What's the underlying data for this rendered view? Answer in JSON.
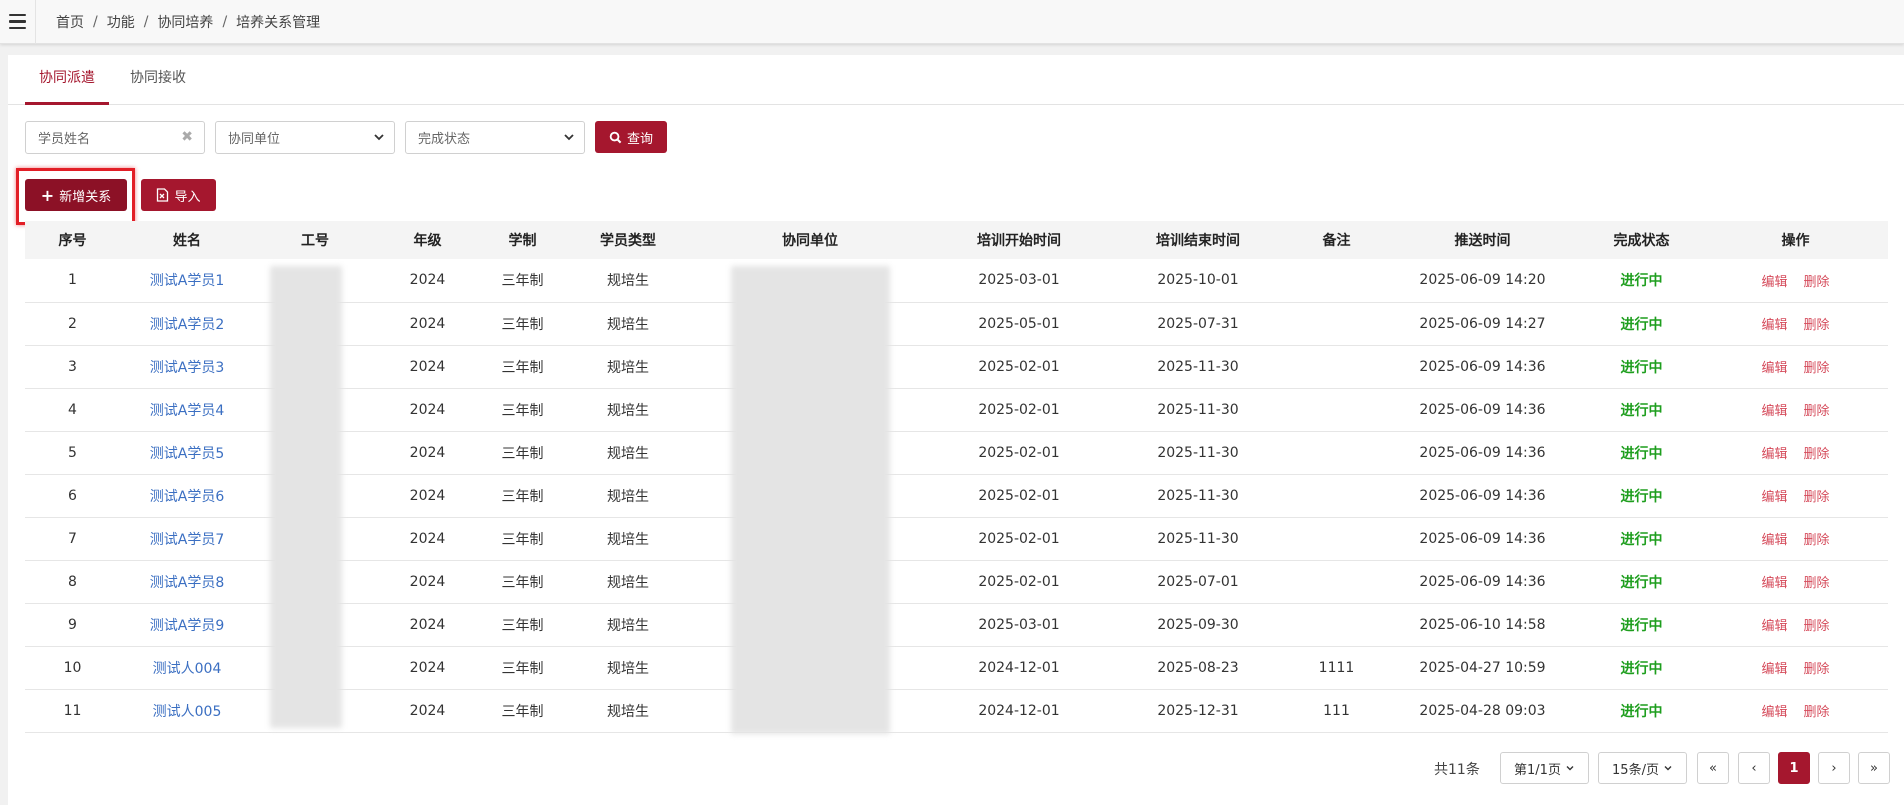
{
  "breadcrumb": [
    "首页",
    "功能",
    "协同培养",
    "培养关系管理"
  ],
  "tabs": [
    "协同派遣",
    "协同接收"
  ],
  "filters": {
    "name_placeholder": "学员姓名",
    "unit_select": "协同单位",
    "status_select": "完成状态",
    "query_label": "查询"
  },
  "actions": {
    "add_label": "新增关系",
    "import_label": "导入"
  },
  "table": {
    "headers": [
      "序号",
      "姓名",
      "工号",
      "年级",
      "学制",
      "学员类型",
      "协同单位",
      "培训开始时间",
      "培训结束时间",
      "备注",
      "推送时间",
      "完成状态",
      "操作"
    ],
    "rows": [
      {
        "no": "1",
        "name": "测试A学员1",
        "grade": "2024",
        "system": "三年制",
        "type": "规培生",
        "start": "2025-03-01",
        "end": "2025-10-01",
        "note": "",
        "push": "2025-06-09 14:20",
        "status": "进行中"
      },
      {
        "no": "2",
        "name": "测试A学员2",
        "grade": "2024",
        "system": "三年制",
        "type": "规培生",
        "start": "2025-05-01",
        "end": "2025-07-31",
        "note": "",
        "push": "2025-06-09 14:27",
        "status": "进行中"
      },
      {
        "no": "3",
        "name": "测试A学员3",
        "grade": "2024",
        "system": "三年制",
        "type": "规培生",
        "start": "2025-02-01",
        "end": "2025-11-30",
        "note": "",
        "push": "2025-06-09 14:36",
        "status": "进行中"
      },
      {
        "no": "4",
        "name": "测试A学员4",
        "grade": "2024",
        "system": "三年制",
        "type": "规培生",
        "start": "2025-02-01",
        "end": "2025-11-30",
        "note": "",
        "push": "2025-06-09 14:36",
        "status": "进行中"
      },
      {
        "no": "5",
        "name": "测试A学员5",
        "grade": "2024",
        "system": "三年制",
        "type": "规培生",
        "start": "2025-02-01",
        "end": "2025-11-30",
        "note": "",
        "push": "2025-06-09 14:36",
        "status": "进行中"
      },
      {
        "no": "6",
        "name": "测试A学员6",
        "grade": "2024",
        "system": "三年制",
        "type": "规培生",
        "start": "2025-02-01",
        "end": "2025-11-30",
        "note": "",
        "push": "2025-06-09 14:36",
        "status": "进行中"
      },
      {
        "no": "7",
        "name": "测试A学员7",
        "grade": "2024",
        "system": "三年制",
        "type": "规培生",
        "start": "2025-02-01",
        "end": "2025-11-30",
        "note": "",
        "push": "2025-06-09 14:36",
        "status": "进行中"
      },
      {
        "no": "8",
        "name": "测试A学员8",
        "grade": "2024",
        "system": "三年制",
        "type": "规培生",
        "start": "2025-02-01",
        "end": "2025-07-01",
        "note": "",
        "push": "2025-06-09 14:36",
        "status": "进行中"
      },
      {
        "no": "9",
        "name": "测试A学员9",
        "grade": "2024",
        "system": "三年制",
        "type": "规培生",
        "start": "2025-03-01",
        "end": "2025-09-30",
        "note": "",
        "push": "2025-06-10 14:58",
        "status": "进行中"
      },
      {
        "no": "10",
        "name": "测试人004",
        "grade": "2024",
        "system": "三年制",
        "type": "规培生",
        "start": "2024-12-01",
        "end": "2025-08-23",
        "note": "1111",
        "push": "2025-04-27 10:59",
        "status": "进行中"
      },
      {
        "no": "11",
        "name": "测试人005",
        "grade": "2024",
        "system": "三年制",
        "type": "规培生",
        "start": "2024-12-01",
        "end": "2025-12-31",
        "note": "111",
        "push": "2025-04-28 09:03",
        "status": "进行中"
      }
    ],
    "edit_label": "编辑",
    "delete_label": "删除"
  },
  "pagination": {
    "total": "共11条",
    "page_info": "第1/1页",
    "page_size": "15条/页",
    "first": "«",
    "prev": "‹",
    "current": "1",
    "next": "›",
    "last": "»"
  },
  "colors": {
    "accent": "#a5172e",
    "status_green": "#1e9e1e",
    "link_blue": "#3b6fc2",
    "action_red": "#d54a5a"
  }
}
